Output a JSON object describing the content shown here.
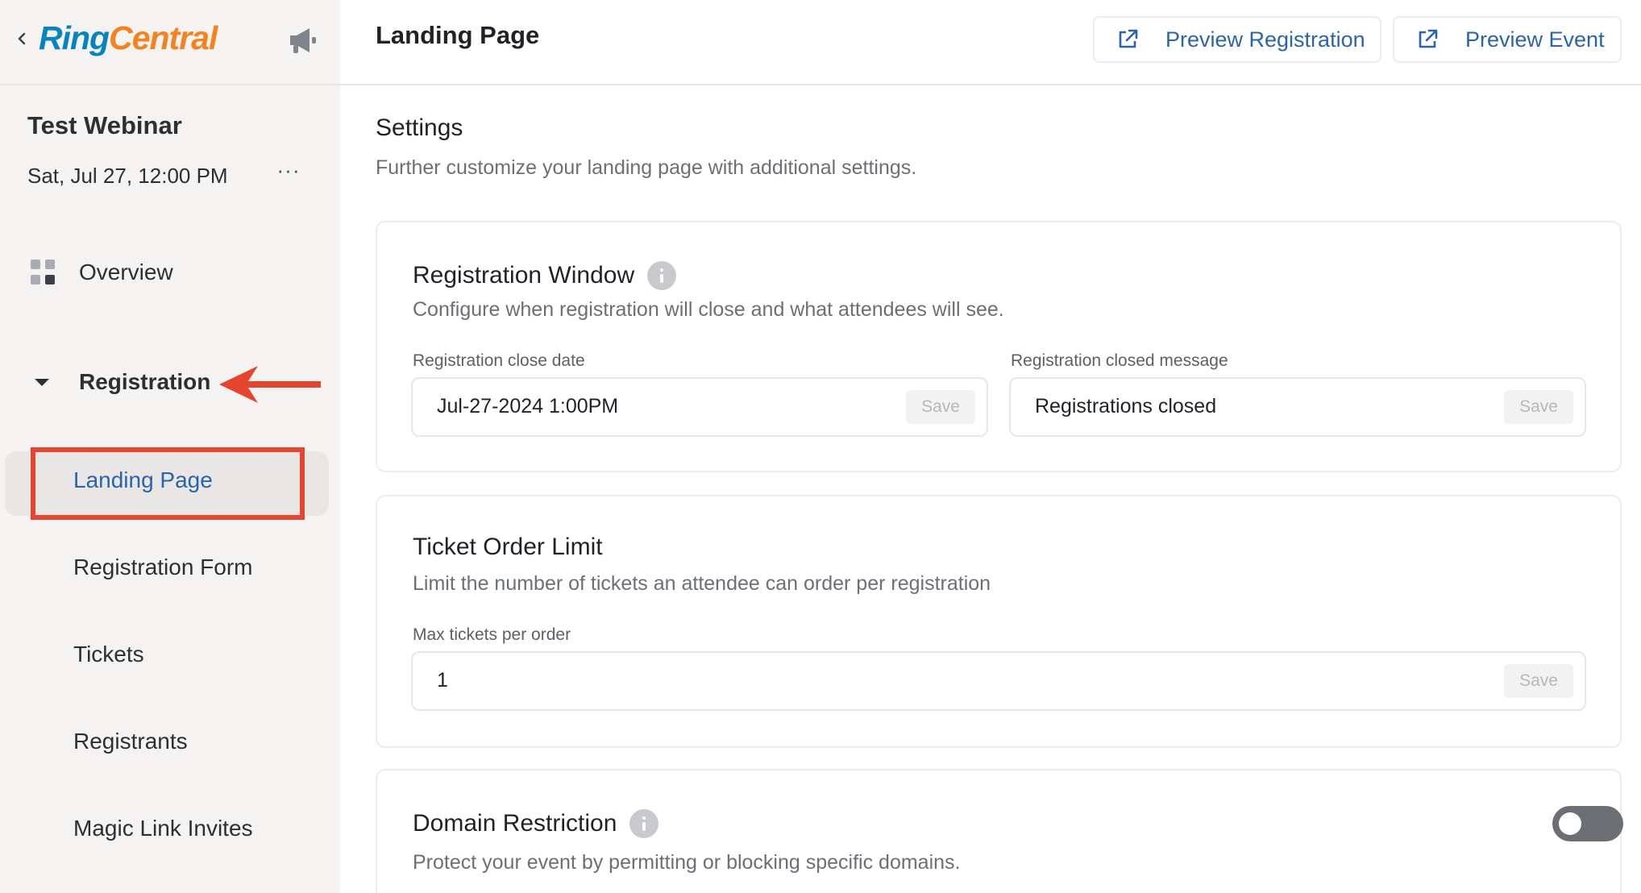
{
  "sidebar": {
    "brand": {
      "part1": "Ring",
      "part2": "Central"
    },
    "event": {
      "title": "Test Webinar",
      "date": "Sat, Jul 27, 12:00 PM",
      "more": "···"
    },
    "overview_label": "Overview",
    "registration_label": "Registration",
    "sub_items": [
      {
        "label": "Landing Page",
        "active": true
      },
      {
        "label": "Registration Form"
      },
      {
        "label": "Tickets"
      },
      {
        "label": "Registrants"
      },
      {
        "label": "Magic Link Invites"
      }
    ]
  },
  "header": {
    "title": "Landing Page",
    "preview_registration": "Preview Registration",
    "preview_event": "Preview Event"
  },
  "settings": {
    "title": "Settings",
    "subtitle": "Further customize your landing page with additional settings."
  },
  "registration_window": {
    "title": "Registration Window",
    "description": "Configure when registration will close and what attendees will see.",
    "close_date_label": "Registration close date",
    "close_date_value": "Jul-27-2024 1:00PM",
    "closed_message_label": "Registration closed message",
    "closed_message_value": "Registrations closed",
    "save_label": "Save"
  },
  "ticket_order_limit": {
    "title": "Ticket Order Limit",
    "description": "Limit the number of tickets an attendee can order per registration",
    "max_label": "Max tickets per order",
    "max_value": "1",
    "save_label": "Save"
  },
  "domain_restriction": {
    "title": "Domain Restriction",
    "description": "Protect your event by permitting or blocking specific domains.",
    "enabled": false
  },
  "colors": {
    "accent_blue": "#2b64a8",
    "highlight_red": "#e5442f",
    "brand_blue": "#0684bd",
    "brand_orange": "#f58220"
  }
}
